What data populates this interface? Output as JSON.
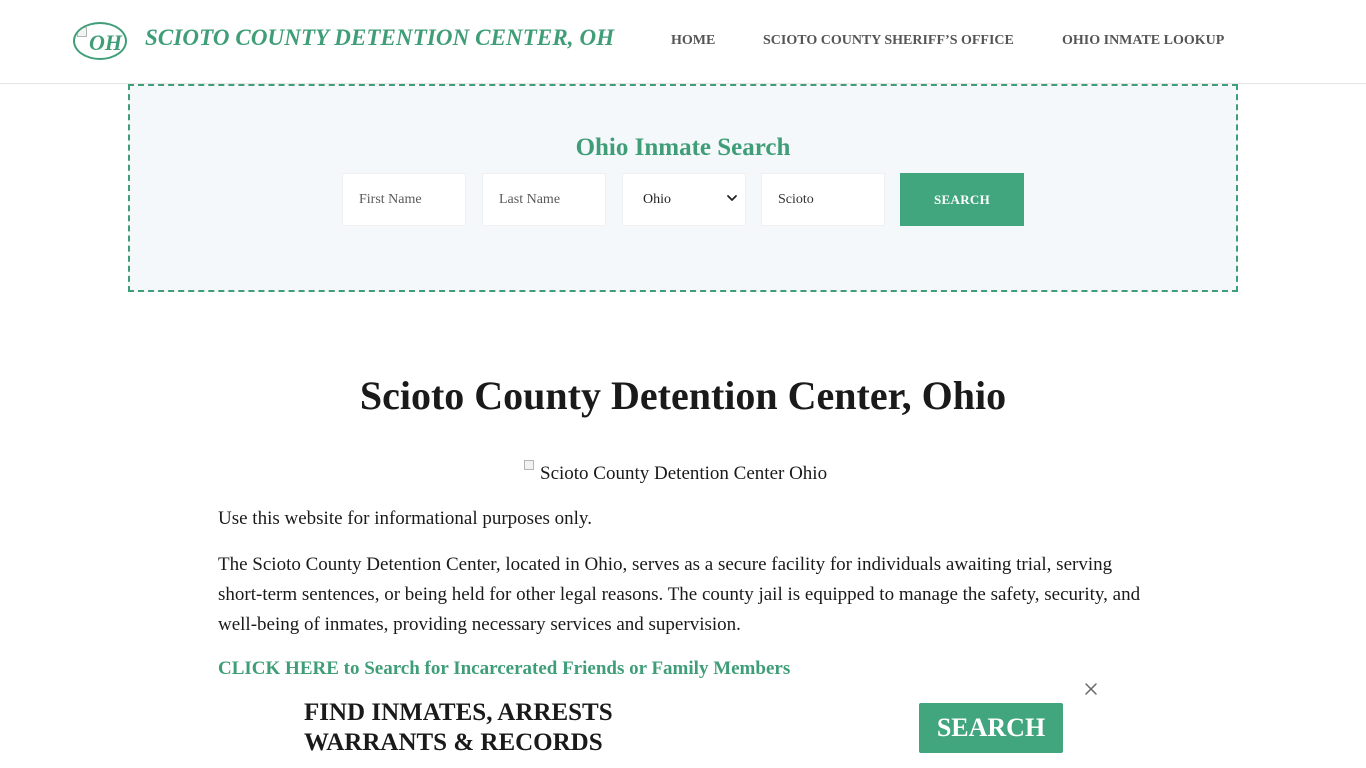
{
  "header": {
    "logo_text": "OH",
    "site_title": "SCIOTO COUNTY DETENTION CENTER, OH",
    "nav": [
      {
        "label": "HOME"
      },
      {
        "label": "SCIOTO COUNTY SHERIFF’S OFFICE"
      },
      {
        "label": "OHIO INMATE LOOKUP"
      }
    ]
  },
  "search": {
    "title": "Ohio Inmate Search",
    "first_name_placeholder": "First Name",
    "last_name_placeholder": "Last Name",
    "state_selected": "Ohio",
    "county_value": "Scioto",
    "button_label": "SEARCH"
  },
  "main": {
    "title": "Scioto County Detention Center, Ohio",
    "image_alt": "Scioto County Detention Center Ohio",
    "paragraphs": [
      "Use this website for informational purposes only.",
      "The Scioto County Detention Center, located in Ohio, serves as a secure facility for individuals awaiting trial, serving short-term sentences, or being held for other legal reasons. The county jail is equipped to manage the safety, security, and well-being of inmates, providing necessary services and supervision."
    ],
    "cta_link": "CLICK HERE to Search for Incarcerated Friends or Family Members"
  },
  "ad": {
    "headline_line1": "FIND INMATES, ARRESTS",
    "headline_line2": "WARRANTS & RECORDS",
    "button_label": "SEARCH"
  },
  "colors": {
    "brand_green": "#3f9e78",
    "button_green": "#41a67d",
    "panel_bg": "#f5f8fa"
  }
}
